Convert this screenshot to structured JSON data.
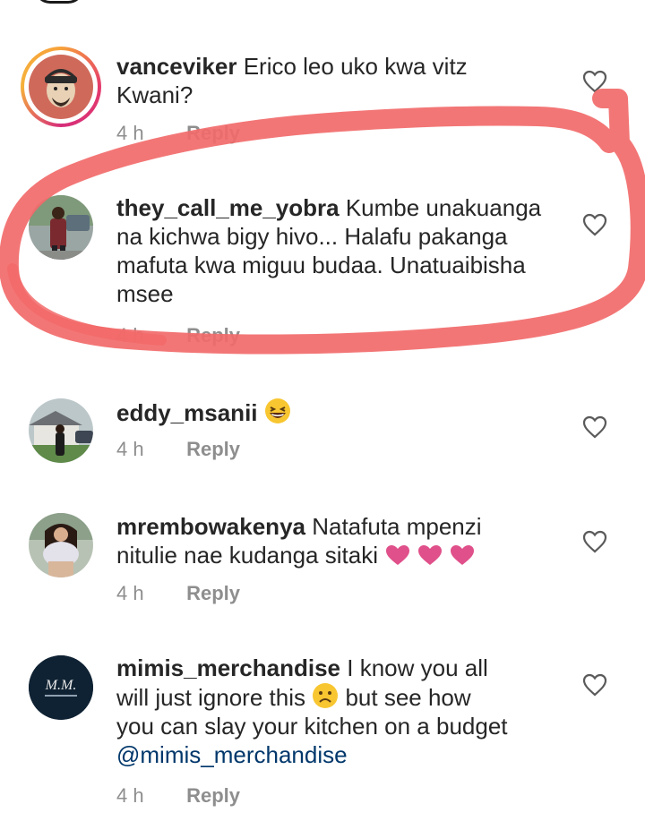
{
  "comments": [
    {
      "username": "vanceviker",
      "text": "Erico leo uko kwa vitz",
      "text_line2": "Kwani?",
      "time": "4 h",
      "reply_label": "Reply"
    },
    {
      "username": "they_call_me_yobra",
      "text": "Kumbe unakuanga",
      "text_line2": "na kichwa bigy hivo... Halafu pakanga",
      "text_line3": "mafuta kwa miguu budaa. Unatuaibisha",
      "text_line4": "msee",
      "time": "4 h",
      "reply_label": "Reply"
    },
    {
      "username": "eddy_msanii",
      "emoji": "grinning-squinting-face",
      "time": "4 h",
      "reply_label": "Reply"
    },
    {
      "username": "mrembowakenya",
      "text": "Natafuta mpenzi",
      "text_line2": "nitulie nae kudanga sitaki",
      "emoji": "three-pink-hearts",
      "time": "4 h",
      "reply_label": "Reply"
    },
    {
      "username": "mimis_merchandise",
      "text": "I know you all",
      "text_line2": "will just ignore this",
      "text_line2b": "but see how",
      "text_line3": "you can slay your kitchen on a budget",
      "mention": "@mimis_merchandise",
      "avatar_text": "M.M.",
      "time": "4 h",
      "reply_label": "Reply"
    }
  ],
  "icons": {
    "like": "heart-outline-icon"
  },
  "colors": {
    "annotation": "#f26a6a",
    "meta_text": "#8e8e8e",
    "mention": "#00376b"
  }
}
